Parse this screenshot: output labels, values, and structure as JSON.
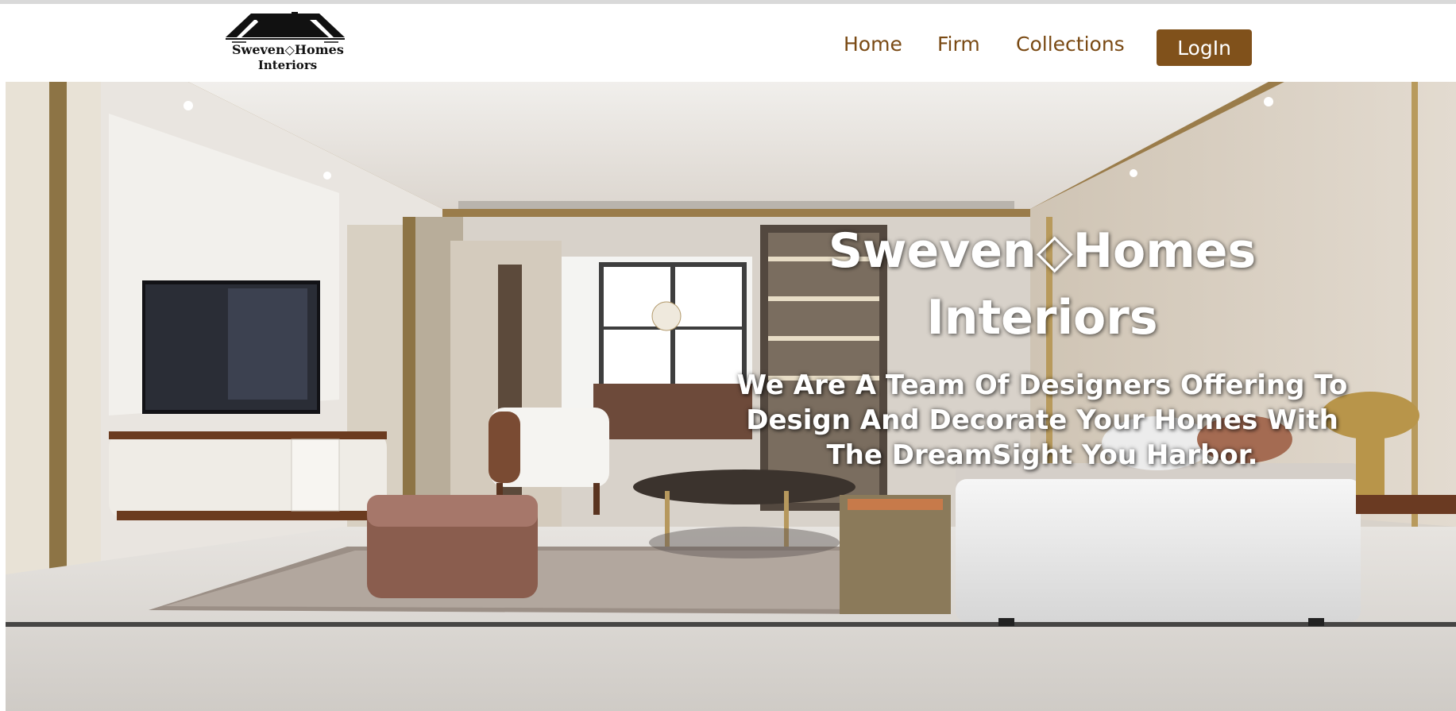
{
  "brand": {
    "logo_line1": "Sweven◇Homes",
    "logo_line2": "Interiors",
    "accent_color": "#80511b"
  },
  "nav": {
    "items": [
      {
        "label": "Home"
      },
      {
        "label": "Firm"
      },
      {
        "label": "Collections"
      }
    ],
    "login_label": "LogIn"
  },
  "hero": {
    "title_line1": "Sweven◇Homes",
    "title_line2": "Interiors",
    "subtitle": "We Are A Team Of Designers Offering To Design And Decorate Your Homes With The DreamSight You Harbor.",
    "image_icon": "living-room-photo"
  }
}
